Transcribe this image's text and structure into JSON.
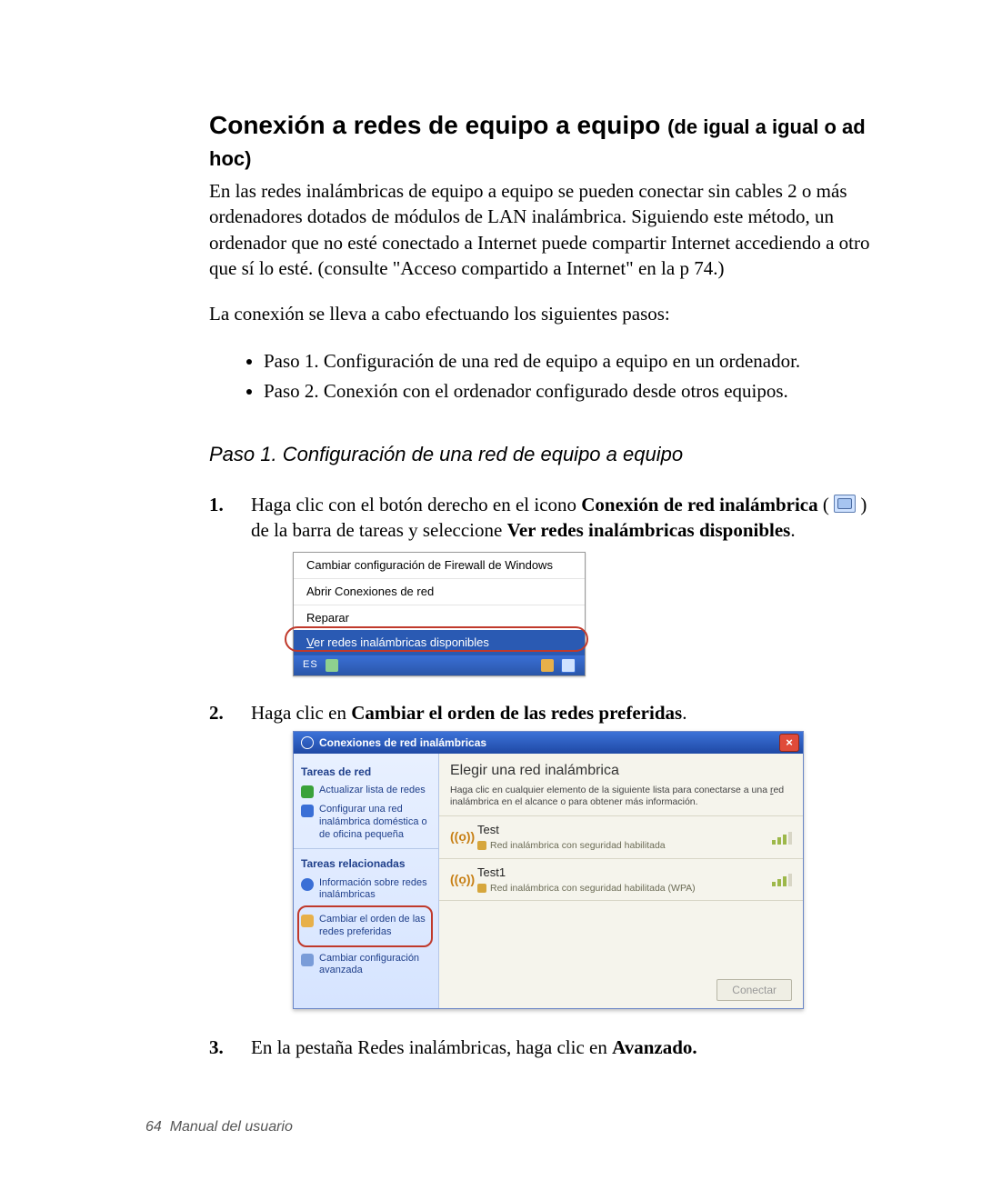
{
  "heading": {
    "main": "Conexión a redes de equipo a equipo ",
    "sub": "(de igual a igual o ad hoc)"
  },
  "intro": "En las redes inalámbricas de equipo a equipo se pueden conectar sin cables 2 o más ordenadores dotados de módulos de LAN inalámbrica. Siguiendo este método, un ordenador que no esté conectado a Internet puede compartir Internet accediendo a otro que sí lo esté. (consulte \"Acceso compartido a Internet\" en la p 74.)",
  "lead": "La conexión se lleva a cabo efectuando los siguientes pasos:",
  "bullets": [
    "Paso 1. Configuración de una red de equipo a equipo en un ordenador.",
    "Paso 2. Conexión con el ordenador configurado desde otros equipos."
  ],
  "section_title": "Paso 1. Configuración de una red de equipo a equipo",
  "steps": {
    "s1": {
      "num": "1.",
      "a": "Haga clic con el botón derecho en el icono ",
      "b": "Conexión de red inalámbrica",
      "c": " ( ",
      "d": " ) de la barra de tareas y seleccione ",
      "e": "Ver redes inalámbricas disponibles",
      "f": "."
    },
    "s2": {
      "num": "2.",
      "a": "Haga clic en ",
      "b": "Cambiar el orden de las redes preferidas",
      "c": "."
    },
    "s3": {
      "num": "3.",
      "a": "En la pestaña Redes inalámbricas, haga clic en ",
      "b": "Avanzado.",
      "c": ""
    }
  },
  "fig1": {
    "items": [
      "Cambiar configuración de Firewall de Windows",
      "Abrir Conexiones de red",
      "Reparar"
    ],
    "highlight_pre": "V",
    "highlight_rest": "er redes inalámbricas disponibles",
    "tray_lang": "ES"
  },
  "fig2": {
    "title": "Conexiones de red inalámbricas",
    "side": {
      "h1": "Tareas de red",
      "l1": "Actualizar lista de redes",
      "l2": "Configurar una red inalámbrica doméstica o de oficina pequeña",
      "h2": "Tareas relacionadas",
      "l3": "Información sobre redes inalámbricas",
      "l4": "Cambiar el orden de las redes preferidas",
      "l5": "Cambiar configuración avanzada"
    },
    "main": {
      "h": "Elegir una red inalámbrica",
      "sub_a": "Haga clic en cualquier elemento de la siguiente lista para conectarse a una ",
      "sub_u": "r",
      "sub_b": "ed inalámbrica en el alcance o para obtener más información.",
      "net1": {
        "name": "Test",
        "desc": "Red inalámbrica con seguridad habilitada"
      },
      "net2": {
        "name": "Test1",
        "desc": "Red inalámbrica con seguridad habilitada (WPA)"
      },
      "connect": "Conectar"
    }
  },
  "footer": {
    "page": "64",
    "label": "Manual del usuario"
  }
}
